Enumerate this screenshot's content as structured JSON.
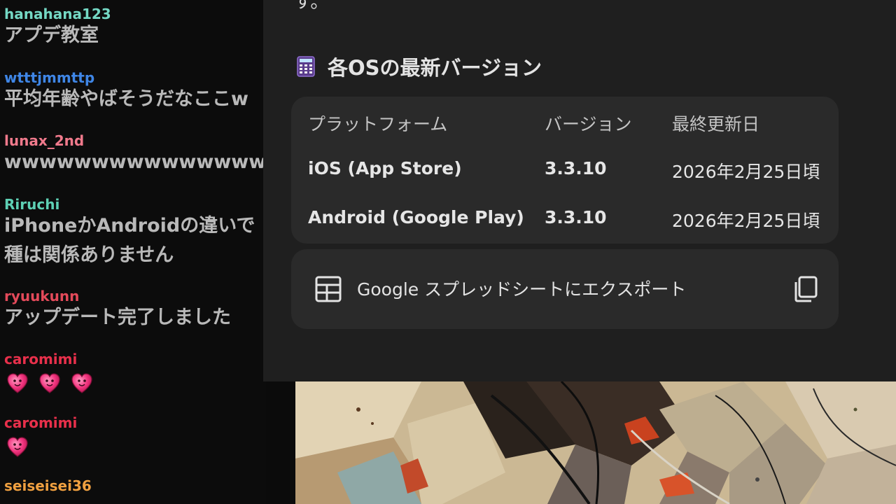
{
  "chat": {
    "messages": [
      {
        "user": "hanahana123",
        "color": "#74d8c4",
        "text": "アプデ教室"
      },
      {
        "user": "wtttjmmttp",
        "color": "#3f86e6",
        "text": "平均年齢やばそうだなここw"
      },
      {
        "user": "lunax_2nd",
        "color": "#f07a8c",
        "text": "wwwwwwwwwwwwwww"
      },
      {
        "user": "Riruchi",
        "color": "#5ed0b4",
        "text": "iPhoneかAndroidの違いで\n種は関係ありません"
      },
      {
        "user": "ryuukunn",
        "color": "#e34a5a",
        "text": "アップデート完了しました"
      },
      {
        "user": "caromimi",
        "color": "#e8304b",
        "emotes": [
          "heart-emote",
          "heart-emote",
          "heart-emote"
        ]
      },
      {
        "user": "caromimi",
        "color": "#e8304b",
        "emotes": [
          "heart-emote"
        ]
      },
      {
        "user": "seiseisei36",
        "color": "#f0a040",
        "text": ""
      }
    ]
  },
  "card": {
    "top_glyph": "す。",
    "heading": "各OSの最新バージョン",
    "heading_icon": "abacus-icon",
    "table": {
      "headers": [
        "プラットフォーム",
        "バージョン",
        "最終更新日"
      ],
      "rows": [
        [
          "iOS (App Store)",
          "3.3.10",
          "2026年2月25日頃"
        ],
        [
          "Android (Google Play)",
          "3.3.10",
          "2026年2月25日頃"
        ]
      ]
    },
    "export": {
      "label": "Google スプレッドシートにエクスポート",
      "icon": "table-icon",
      "copy_icon": "copy-icon"
    }
  },
  "colors": {
    "card_bg": "#1f1f1f",
    "panel_bg": "#2a2a2a",
    "chat_bg": "#0c0c0c",
    "text_primary": "#e3e3e3",
    "chat_text": "#b9b9b9"
  }
}
